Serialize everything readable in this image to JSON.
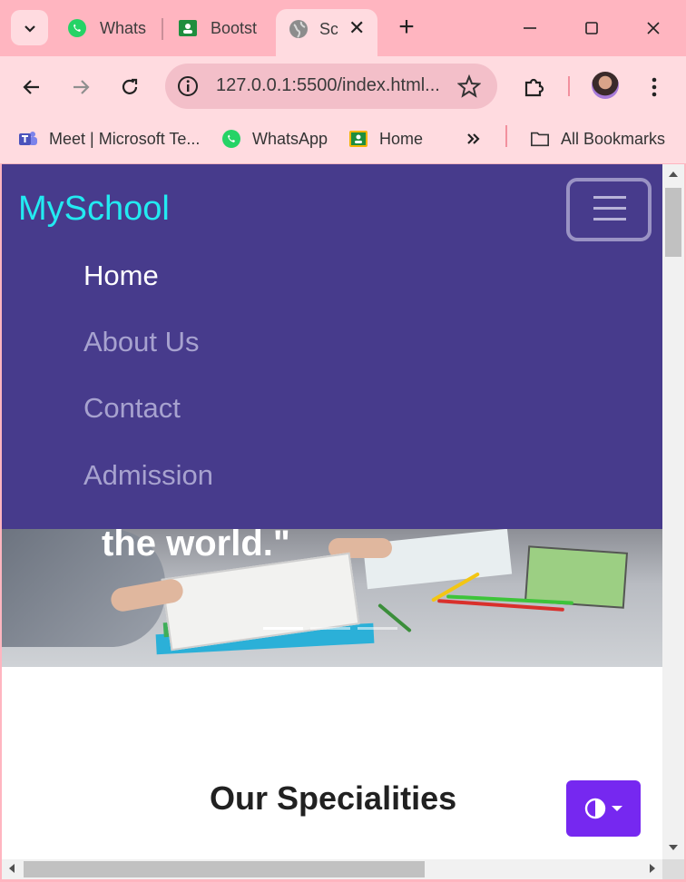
{
  "browser": {
    "tabs": [
      {
        "title": "Whats",
        "icon": "whatsapp-icon"
      },
      {
        "title": "Bootst",
        "icon": "classroom-icon"
      },
      {
        "title": "Sc",
        "icon": "globe-icon",
        "active": true
      }
    ],
    "address": {
      "url": "127.0.0.1:5500/index.html..."
    },
    "bookmarks": [
      {
        "label": "Meet | Microsoft Te...",
        "icon": "teams-icon"
      },
      {
        "label": "WhatsApp",
        "icon": "whatsapp-icon"
      },
      {
        "label": "Home",
        "icon": "classroom-icon"
      }
    ],
    "all_bookmarks": "All Bookmarks"
  },
  "navbar": {
    "brand": "MySchool",
    "links": [
      {
        "label": "Home",
        "active": true
      },
      {
        "label": "About Us",
        "active": false
      },
      {
        "label": "Contact",
        "active": false
      },
      {
        "label": "Admission",
        "active": false
      }
    ]
  },
  "hero": {
    "caption": "the world.\""
  },
  "specialities": {
    "title": "Our Specialities"
  },
  "colors": {
    "navbar_bg": "#473b8c",
    "brand": "#23eaf1",
    "theme_button": "#7628f0",
    "chrome": "#ffb5c0"
  }
}
